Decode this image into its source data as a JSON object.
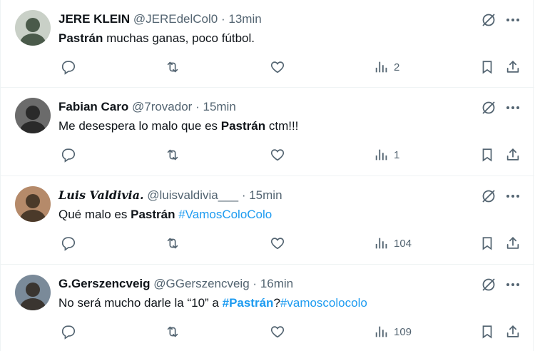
{
  "tweets": [
    {
      "name": "JERE KLEIN",
      "handle": "@JEREdelCol0",
      "sep": "·",
      "time": "13min",
      "parts": [
        {
          "t": "Pastrán",
          "style": "bold"
        },
        {
          "t": " muchas ganas, poco fútbol.",
          "style": "plain"
        }
      ],
      "views": "2",
      "avatar_colors": [
        "#c9d0c7",
        "#4a5a4a"
      ]
    },
    {
      "name": "Fabian Caro",
      "handle": "@7rovador",
      "sep": "·",
      "time": "15min",
      "parts": [
        {
          "t": "Me desespera lo malo que es ",
          "style": "plain"
        },
        {
          "t": "Pastrán",
          "style": "bold"
        },
        {
          "t": " ctm!!!",
          "style": "plain"
        }
      ],
      "views": "1",
      "avatar_colors": [
        "#6b6b6b",
        "#2a2a2a"
      ]
    },
    {
      "name": "Luis Valdivia.",
      "handle": "@luisvaldivia___",
      "sep": "·",
      "time": "15min",
      "parts": [
        {
          "t": "Qué malo es ",
          "style": "plain"
        },
        {
          "t": "Pastrán",
          "style": "bold"
        },
        {
          "t": " ",
          "style": "plain"
        },
        {
          "t": "#VamosColoColo",
          "style": "hashtag"
        }
      ],
      "views": "104",
      "avatar_colors": [
        "#b58a6a",
        "#4b3a2a"
      ]
    },
    {
      "name": "G.Gerszencveig",
      "handle": "@GGerszencveig",
      "sep": "·",
      "time": "16min",
      "parts": [
        {
          "t": "No será mucho darle la “10” a ",
          "style": "plain"
        },
        {
          "t": "#Pastrán",
          "style": "hashtag-bold"
        },
        {
          "t": "?",
          "style": "plain"
        },
        {
          "t": "#vamoscolocolo",
          "style": "hashtag"
        }
      ],
      "views": "109",
      "avatar_colors": [
        "#7a8a99",
        "#3a3530"
      ]
    }
  ]
}
